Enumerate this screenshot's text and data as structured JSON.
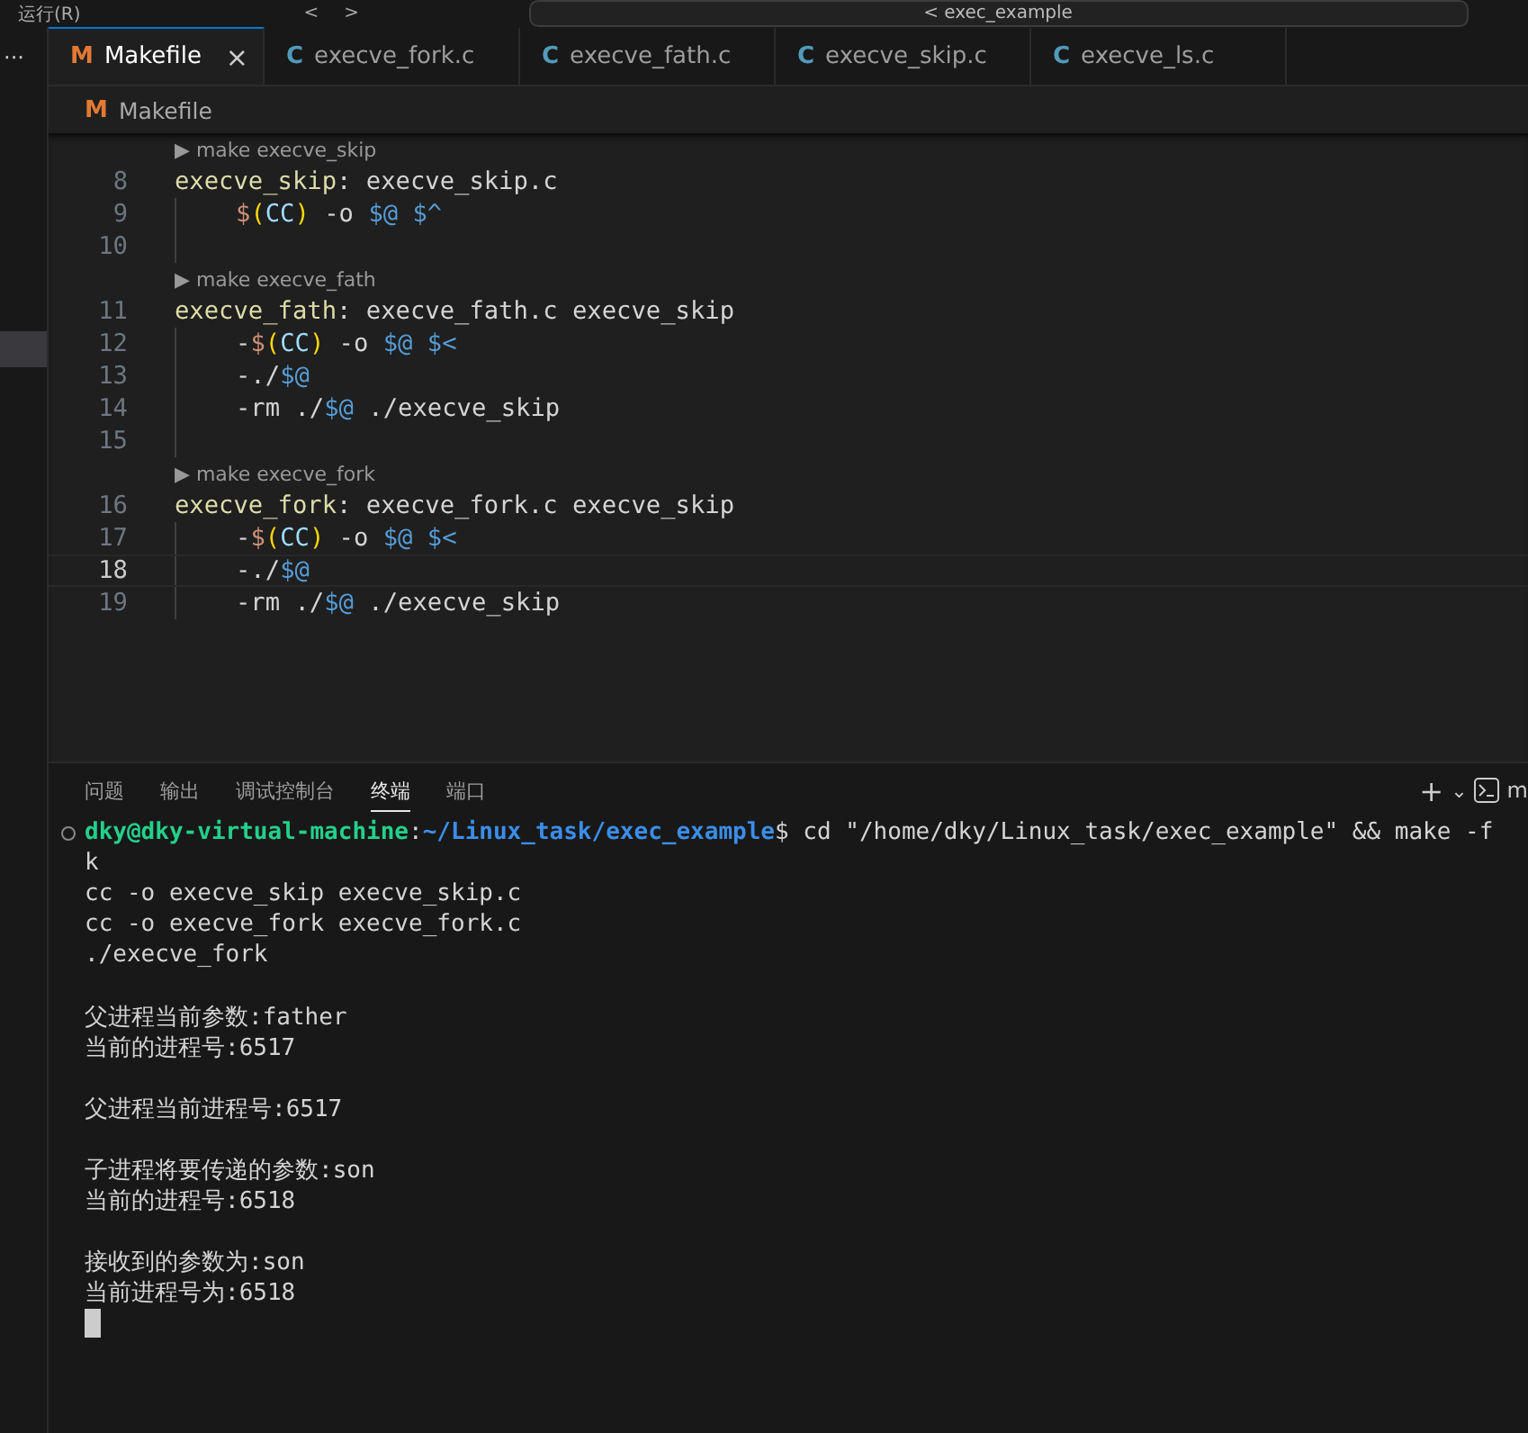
{
  "title_bar": {
    "menu": "运行(R)",
    "nav_back": "<",
    "nav_forward": ">",
    "search": "< exec_example"
  },
  "activity_bar": {
    "more": "···"
  },
  "tabs": [
    {
      "icon": "M",
      "kind": "makefile",
      "label": "Makefile",
      "selected": true,
      "close": "×"
    },
    {
      "icon": "C",
      "kind": "c",
      "label": "execve_fork.c",
      "selected": false
    },
    {
      "icon": "C",
      "kind": "c",
      "label": "execve_fath.c",
      "selected": false
    },
    {
      "icon": "C",
      "kind": "c",
      "label": "execve_skip.c",
      "selected": false
    },
    {
      "icon": "C",
      "kind": "c",
      "label": "execve_ls.c",
      "selected": false
    }
  ],
  "breadcrumb": {
    "icon": "M",
    "kind": "makefile",
    "label": "Makefile"
  },
  "editor_lines": [
    {
      "kind": "codelens",
      "arrow": "▶",
      "text": "make execve_skip"
    },
    {
      "kind": "code",
      "number": "8",
      "current": false,
      "guide": false,
      "tokens": [
        {
          "kind": "target",
          "text": "execve_skip"
        },
        {
          "kind": "text",
          "text": ": execve_skip.c"
        }
      ]
    },
    {
      "kind": "code",
      "number": "9",
      "current": false,
      "guide": true,
      "tokens": [
        {
          "kind": "dollar",
          "text": "$"
        },
        {
          "kind": "paren",
          "text": "("
        },
        {
          "kind": "var",
          "text": "CC"
        },
        {
          "kind": "paren",
          "text": ")"
        },
        {
          "kind": "text",
          "text": " -o "
        },
        {
          "kind": "auto",
          "text": "$@ $^"
        }
      ]
    },
    {
      "kind": "code",
      "number": "10",
      "current": false,
      "guide": true
    },
    {
      "kind": "codelens",
      "arrow": "▶",
      "text": "make execve_fath"
    },
    {
      "kind": "code",
      "number": "11",
      "current": false,
      "guide": false,
      "tokens": [
        {
          "kind": "target",
          "text": "execve_fath"
        },
        {
          "kind": "text",
          "text": ": execve_fath.c execve_skip"
        }
      ]
    },
    {
      "kind": "code",
      "number": "12",
      "current": false,
      "guide": true,
      "tokens": [
        {
          "kind": "text",
          "text": "-"
        },
        {
          "kind": "dollar",
          "text": "$"
        },
        {
          "kind": "paren",
          "text": "("
        },
        {
          "kind": "var",
          "text": "CC"
        },
        {
          "kind": "paren",
          "text": ")"
        },
        {
          "kind": "text",
          "text": " -o "
        },
        {
          "kind": "auto",
          "text": "$@ $<"
        }
      ]
    },
    {
      "kind": "code",
      "number": "13",
      "current": false,
      "guide": true,
      "tokens": [
        {
          "kind": "text",
          "text": "-./"
        },
        {
          "kind": "auto",
          "text": "$@"
        }
      ]
    },
    {
      "kind": "code",
      "number": "14",
      "current": false,
      "guide": true,
      "tokens": [
        {
          "kind": "text",
          "text": "-rm ./"
        },
        {
          "kind": "auto",
          "text": "$@"
        },
        {
          "kind": "text",
          "text": " ./execve_skip"
        }
      ]
    },
    {
      "kind": "code",
      "number": "15",
      "current": false,
      "guide": true
    },
    {
      "kind": "codelens",
      "arrow": "▶",
      "text": "make execve_fork"
    },
    {
      "kind": "code",
      "number": "16",
      "current": false,
      "guide": false,
      "tokens": [
        {
          "kind": "target",
          "text": "execve_fork"
        },
        {
          "kind": "text",
          "text": ": execve_fork.c execve_skip"
        }
      ]
    },
    {
      "kind": "code",
      "number": "17",
      "current": false,
      "guide": true,
      "tokens": [
        {
          "kind": "text",
          "text": "-"
        },
        {
          "kind": "dollar",
          "text": "$"
        },
        {
          "kind": "paren",
          "text": "("
        },
        {
          "kind": "var",
          "text": "CC"
        },
        {
          "kind": "paren",
          "text": ")"
        },
        {
          "kind": "text",
          "text": " -o "
        },
        {
          "kind": "auto",
          "text": "$@ $<"
        }
      ]
    },
    {
      "kind": "code",
      "number": "18",
      "current": true,
      "guide": true,
      "tokens": [
        {
          "kind": "text",
          "text": "-./"
        },
        {
          "kind": "auto",
          "text": "$@"
        }
      ]
    },
    {
      "kind": "code",
      "number": "19",
      "current": false,
      "guide": true,
      "tokens": [
        {
          "kind": "text",
          "text": "-rm ./"
        },
        {
          "kind": "auto",
          "text": "$@"
        },
        {
          "kind": "text",
          "text": " ./execve_skip"
        }
      ]
    }
  ],
  "panel": {
    "tabs": [
      {
        "label": "问题",
        "selected": false
      },
      {
        "label": "输出",
        "selected": false
      },
      {
        "label": "调试控制台",
        "selected": false
      },
      {
        "label": "终端",
        "selected": true
      },
      {
        "label": "端口",
        "selected": false
      }
    ],
    "actions": {
      "new": "+",
      "dropdown": "⌄",
      "terminal_label": "m"
    }
  },
  "terminal_lines": [
    {
      "tokens": [
        {
          "kind": "user",
          "text": "dky@dky-virtual-machine"
        },
        {
          "kind": "text",
          "text": ":"
        },
        {
          "kind": "path",
          "text": "~/Linux_task/exec_example"
        },
        {
          "kind": "text",
          "text": "$ cd \"/home/dky/Linux_task/exec_example\" && make -f"
        }
      ],
      "decoration": true
    },
    {
      "tokens": [
        {
          "kind": "text",
          "text": "k"
        }
      ],
      "decoration": false
    },
    {
      "tokens": [
        {
          "kind": "text",
          "text": "cc -o execve_skip execve_skip.c"
        }
      ],
      "decoration": false
    },
    {
      "tokens": [
        {
          "kind": "text",
          "text": "cc -o execve_fork execve_fork.c"
        }
      ],
      "decoration": false
    },
    {
      "tokens": [
        {
          "kind": "text",
          "text": "./execve_fork"
        }
      ],
      "decoration": false
    },
    {
      "decoration": false
    },
    {
      "tokens": [
        {
          "kind": "text",
          "text": "父进程当前参数:father"
        }
      ],
      "decoration": false
    },
    {
      "tokens": [
        {
          "kind": "text",
          "text": "当前的进程号:6517"
        }
      ],
      "decoration": false
    },
    {
      "decoration": false
    },
    {
      "tokens": [
        {
          "kind": "text",
          "text": "父进程当前进程号:6517"
        }
      ],
      "decoration": false
    },
    {
      "decoration": false
    },
    {
      "tokens": [
        {
          "kind": "text",
          "text": "子进程将要传递的参数:son"
        }
      ],
      "decoration": false
    },
    {
      "tokens": [
        {
          "kind": "text",
          "text": "当前的进程号:6518"
        }
      ],
      "decoration": false
    },
    {
      "decoration": false
    },
    {
      "tokens": [
        {
          "kind": "text",
          "text": "接收到的参数为:son"
        }
      ],
      "decoration": false
    },
    {
      "tokens": [
        {
          "kind": "text",
          "text": "当前进程号为:6518"
        }
      ],
      "decoration": false
    }
  ]
}
